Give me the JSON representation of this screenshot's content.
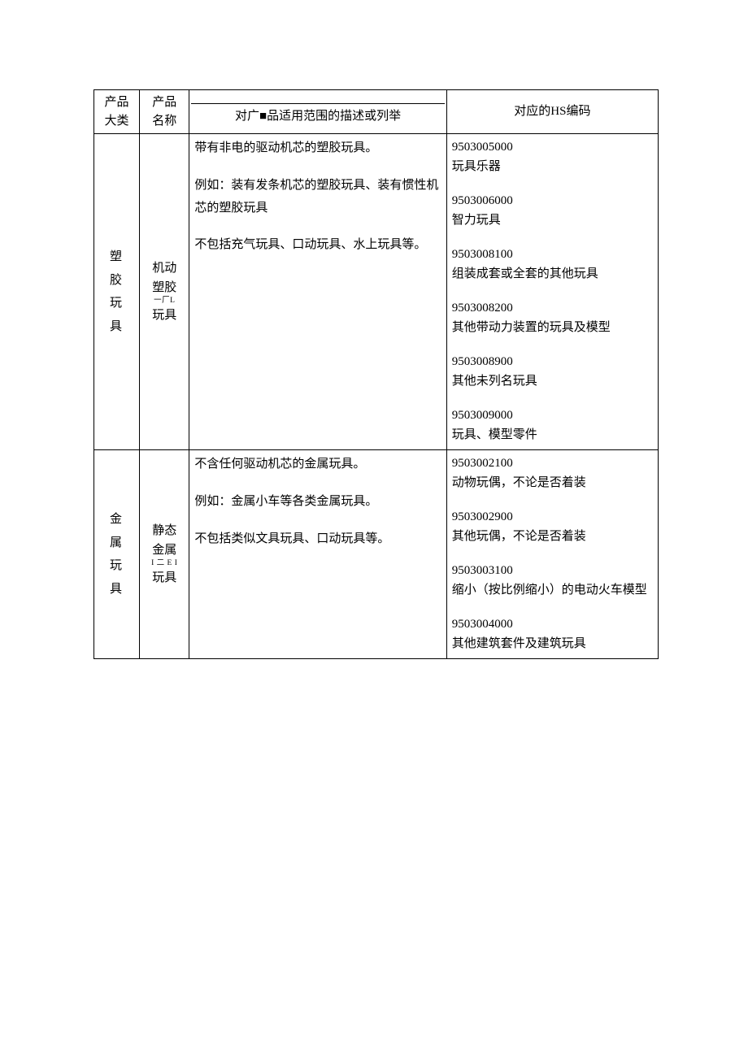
{
  "headers": {
    "category": "产品\n大类",
    "name": "产品\n名称",
    "desc": "对广■品适用范围的描述或列举",
    "hs": "对应的HS编码"
  },
  "rows": [
    {
      "category_vertical": "塑\n胶\n玩\n具",
      "name_l1": "机动",
      "name_l2": "塑胶",
      "name_tiny": "一厂L",
      "name_l3": "玩具",
      "desc": [
        "带有非电的驱动机芯的塑胶玩具。",
        "例如：装有发条机芯的塑胶玩具、装有惯性机芯的塑胶玩具",
        "不包括充气玩具、口动玩具、水上玩具等。"
      ],
      "hs": [
        {
          "code": "9503005000",
          "label": "玩具乐器"
        },
        {
          "code": "9503006000",
          "label": "智力玩具"
        },
        {
          "code": "9503008100",
          "label": "组装成套或全套的其他玩具"
        },
        {
          "code": "9503008200",
          "label": "其他带动力装置的玩具及模型"
        },
        {
          "code": "9503008900",
          "label": "其他未列名玩具"
        },
        {
          "code": "9503009000",
          "label": "玩具、模型零件"
        }
      ]
    },
    {
      "category_vertical": "金\n属\n玩\n具",
      "name_l1": "静态",
      "name_l2": "金属",
      "name_tiny": "I 二 E I",
      "name_l3": "玩具",
      "desc": [
        "不含任何驱动机芯的金属玩具。",
        "例如：金属小车等各类金属玩具。",
        "不包括类似文具玩具、口动玩具等。"
      ],
      "hs": [
        {
          "code": "9503002100",
          "label": "动物玩偶，不论是否着装"
        },
        {
          "code": "9503002900",
          "label": "其他玩偶，不论是否着装"
        },
        {
          "code": "9503003100",
          "label": "缩小（按比例缩小）的电动火车模型"
        },
        {
          "code": "9503004000",
          "label": "其他建筑套件及建筑玩具"
        }
      ]
    }
  ]
}
